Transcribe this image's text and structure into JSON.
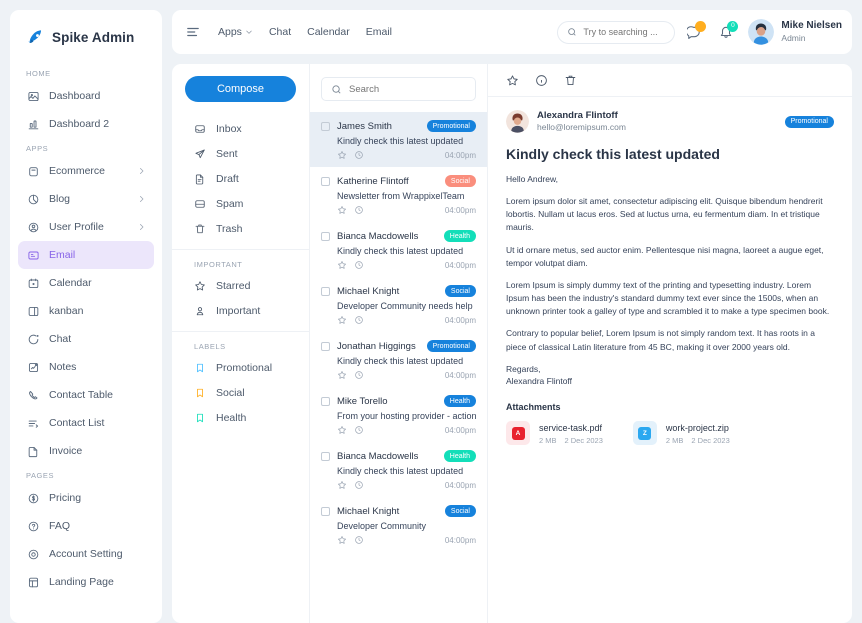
{
  "brand": {
    "name": "Spike Admin",
    "icon": "rocket-icon"
  },
  "sidebar": {
    "sections": [
      {
        "label": "HOME",
        "items": [
          {
            "label": "Dashboard",
            "icon": "dashboard-icon",
            "active": false,
            "chevron": false
          },
          {
            "label": "Dashboard 2",
            "icon": "bar-chart-icon",
            "active": false,
            "chevron": false
          }
        ]
      },
      {
        "label": "APPS",
        "items": [
          {
            "label": "Ecommerce",
            "icon": "bag-icon",
            "active": false,
            "chevron": true
          },
          {
            "label": "Blog",
            "icon": "pie-icon",
            "active": false,
            "chevron": true
          },
          {
            "label": "User Profile",
            "icon": "user-circle-icon",
            "active": false,
            "chevron": true
          },
          {
            "label": "Email",
            "icon": "mail-icon",
            "active": true,
            "chevron": false
          },
          {
            "label": "Calendar",
            "icon": "calendar-icon",
            "active": false,
            "chevron": false
          },
          {
            "label": "kanban",
            "icon": "kanban-icon",
            "active": false,
            "chevron": false
          },
          {
            "label": "Chat",
            "icon": "chat-icon",
            "active": false,
            "chevron": false
          },
          {
            "label": "Notes",
            "icon": "notes-icon",
            "active": false,
            "chevron": false
          },
          {
            "label": "Contact Table",
            "icon": "phone-icon",
            "active": false,
            "chevron": false
          },
          {
            "label": "Contact List",
            "icon": "list-icon",
            "active": false,
            "chevron": false
          },
          {
            "label": "Invoice",
            "icon": "invoice-icon",
            "active": false,
            "chevron": false
          }
        ]
      },
      {
        "label": "PAGES",
        "items": [
          {
            "label": "Pricing",
            "icon": "dollar-circle-icon",
            "active": false,
            "chevron": false
          },
          {
            "label": "FAQ",
            "icon": "question-circle-icon",
            "active": false,
            "chevron": false
          },
          {
            "label": "Account Setting",
            "icon": "settings-icon",
            "active": false,
            "chevron": false
          },
          {
            "label": "Landing Page",
            "icon": "layout-icon",
            "active": false,
            "chevron": false
          }
        ]
      }
    ]
  },
  "topbar": {
    "menu_icon": "hamburger-icon",
    "nav": [
      {
        "label": "Apps",
        "caret": true
      },
      {
        "label": "Chat",
        "caret": false
      },
      {
        "label": "Calendar",
        "caret": false
      },
      {
        "label": "Email",
        "caret": false
      }
    ],
    "search": {
      "placeholder": "Try to searching ...",
      "value": "",
      "icon": "search-icon"
    },
    "message_badge": "",
    "notification_badge": "0",
    "user": {
      "name": "Mike Nielsen",
      "role": "Admin"
    }
  },
  "mailnav": {
    "compose_label": "Compose",
    "folders": [
      {
        "label": "Inbox",
        "icon": "inbox-icon"
      },
      {
        "label": "Sent",
        "icon": "send-icon"
      },
      {
        "label": "Draft",
        "icon": "draft-icon"
      },
      {
        "label": "Spam",
        "icon": "spam-icon"
      },
      {
        "label": "Trash",
        "icon": "trash-icon"
      }
    ],
    "important_label": "IMPORTANT",
    "important": [
      {
        "label": "Starred",
        "icon": "star-icon"
      },
      {
        "label": "Important",
        "icon": "important-icon"
      }
    ],
    "labels_label": "LABELS",
    "labels": [
      {
        "label": "Promotional",
        "icon": "bookmark-icon",
        "color": "#49beff"
      },
      {
        "label": "Social",
        "icon": "bookmark-icon",
        "color": "#ffae1f"
      },
      {
        "label": "Health",
        "icon": "bookmark-icon",
        "color": "#13deb9"
      }
    ]
  },
  "maillist": {
    "search": {
      "placeholder": "Search",
      "value": "",
      "icon": "search-icon"
    },
    "rows": [
      {
        "name": "James Smith",
        "subject": "Kindly check this latest updated",
        "tag": "Promotional",
        "tag_color": "#1682dc",
        "time": "04:00pm",
        "selected": true,
        "starred": false
      },
      {
        "name": "Katherine Flintoff",
        "subject": "Newsletter from WrappixelTeam",
        "tag": "Social",
        "tag_color": "#fa8e7d",
        "time": "04:00pm",
        "selected": false,
        "starred": true
      },
      {
        "name": "Bianca Macdowells",
        "subject": "Kindly check this latest updated",
        "tag": "Health",
        "tag_color": "#13deb9",
        "time": "04:00pm",
        "selected": false,
        "starred": false
      },
      {
        "name": "Michael Knight",
        "subject": "Developer Community needs help",
        "tag": "Social",
        "tag_color": "#1682dc",
        "time": "04:00pm",
        "selected": false,
        "starred": false
      },
      {
        "name": "Jonathan Higgings",
        "subject": "Kindly check this latest updated",
        "tag": "Promotional",
        "tag_color": "#1682dc",
        "time": "04:00pm",
        "selected": false,
        "starred": false
      },
      {
        "name": "Mike Torello",
        "subject": "From your hosting provider - action",
        "tag": "Health",
        "tag_color": "#1682dc",
        "time": "04:00pm",
        "selected": false,
        "starred": false
      },
      {
        "name": "Bianca Macdowells",
        "subject": "Kindly check this latest updated",
        "tag": "Health",
        "tag_color": "#13deb9",
        "time": "04:00pm",
        "selected": false,
        "starred": false
      },
      {
        "name": "Michael Knight",
        "subject": "Developer Community",
        "tag": "Social",
        "tag_color": "#1682dc",
        "time": "04:00pm",
        "selected": false,
        "starred": false
      }
    ]
  },
  "reader": {
    "tools": [
      {
        "icon": "star-icon",
        "name": "star-button"
      },
      {
        "icon": "info-icon",
        "name": "info-button"
      },
      {
        "icon": "trash-icon",
        "name": "delete-button"
      }
    ],
    "sender_name": "Alexandra Flintoff",
    "sender_email": "hello@loremipsum.com",
    "tag": "Promotional",
    "tag_color": "#1682dc",
    "subject": "Kindly check this latest updated",
    "greeting": "Hello Andrew,",
    "paragraphs": [
      "Lorem ipsum dolor sit amet, consectetur adipiscing elit. Quisque bibendum hendrerit lobortis. Nullam ut lacus eros. Sed at luctus urna, eu fermentum diam. In et tristique mauris.",
      "Ut id ornare metus, sed auctor enim. Pellentesque nisi magna, laoreet a augue eget, tempor volutpat diam.",
      "Lorem Ipsum is simply dummy text of the printing and typesetting industry. Lorem Ipsum has been the industry's standard dummy text ever since the 1500s, when an unknown printer took a galley of type and scrambled it to make a type specimen book.",
      "Contrary to popular belief, Lorem Ipsum is not simply random text. It has roots in a piece of classical Latin literature from 45 BC, making it over 2000 years old."
    ],
    "signoff_line1": "Regards,",
    "signoff_line2": "Alexandra Flintoff",
    "attachments_title": "Attachments",
    "attachments": [
      {
        "name": "service-task.pdf",
        "size": "2 MB",
        "date": "2 Dec 2023",
        "type": "pdf",
        "badge": "A"
      },
      {
        "name": "work-project.zip",
        "size": "2 MB",
        "date": "2 Dec 2023",
        "type": "zip",
        "badge": "Z"
      }
    ]
  }
}
